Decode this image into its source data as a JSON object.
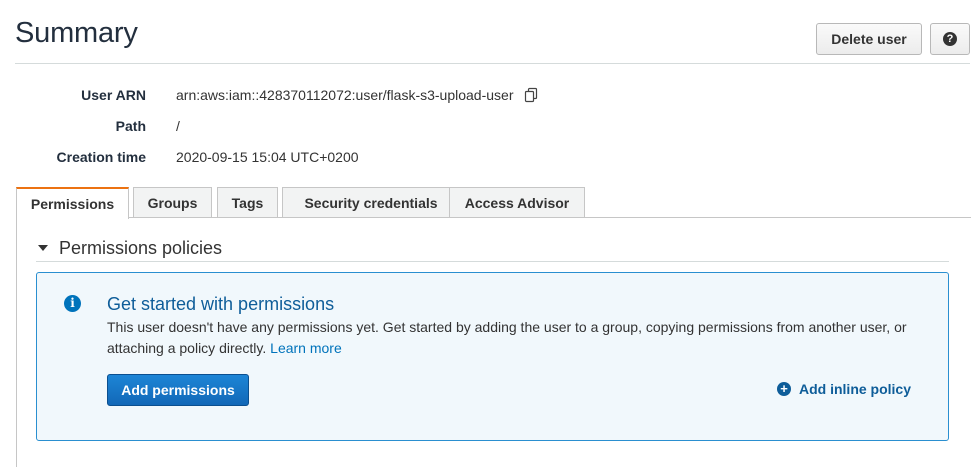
{
  "header": {
    "title": "Summary",
    "delete_label": "Delete user",
    "help_icon": "?"
  },
  "meta": [
    {
      "label": "User ARN",
      "value": "arn:aws:iam::428370112072:user/flask-s3-upload-user"
    },
    {
      "label": "Path",
      "value": "/"
    },
    {
      "label": "Creation time",
      "value": "2020-09-15 15:04 UTC+0200"
    }
  ],
  "tabs": [
    {
      "label": "Permissions",
      "active": true
    },
    {
      "label": "Groups",
      "active": false
    },
    {
      "label": "Tags",
      "active": false
    },
    {
      "label": "Security credentials",
      "active": false
    },
    {
      "label": "Access Advisor",
      "active": false
    }
  ],
  "permissions": {
    "section_title": "Permissions policies",
    "info_title": "Get started with permissions",
    "info_text": "This user doesn't have any permissions yet. Get started by adding the user to a group, copying permissions from another user, or attaching a policy directly.",
    "learn_more": "Learn more",
    "add_permissions_label": "Add permissions",
    "add_inline_label": "Add inline policy"
  },
  "colors": {
    "accent_tab": "#ec7211",
    "primary_button": "#1268b7",
    "info_bg": "#f1f8fc",
    "info_border": "#2a8fd0",
    "link": "#0073bb"
  },
  "icons": [
    "copy-icon",
    "help-icon",
    "caret-down-icon",
    "info-icon",
    "plus-circle-icon"
  ]
}
